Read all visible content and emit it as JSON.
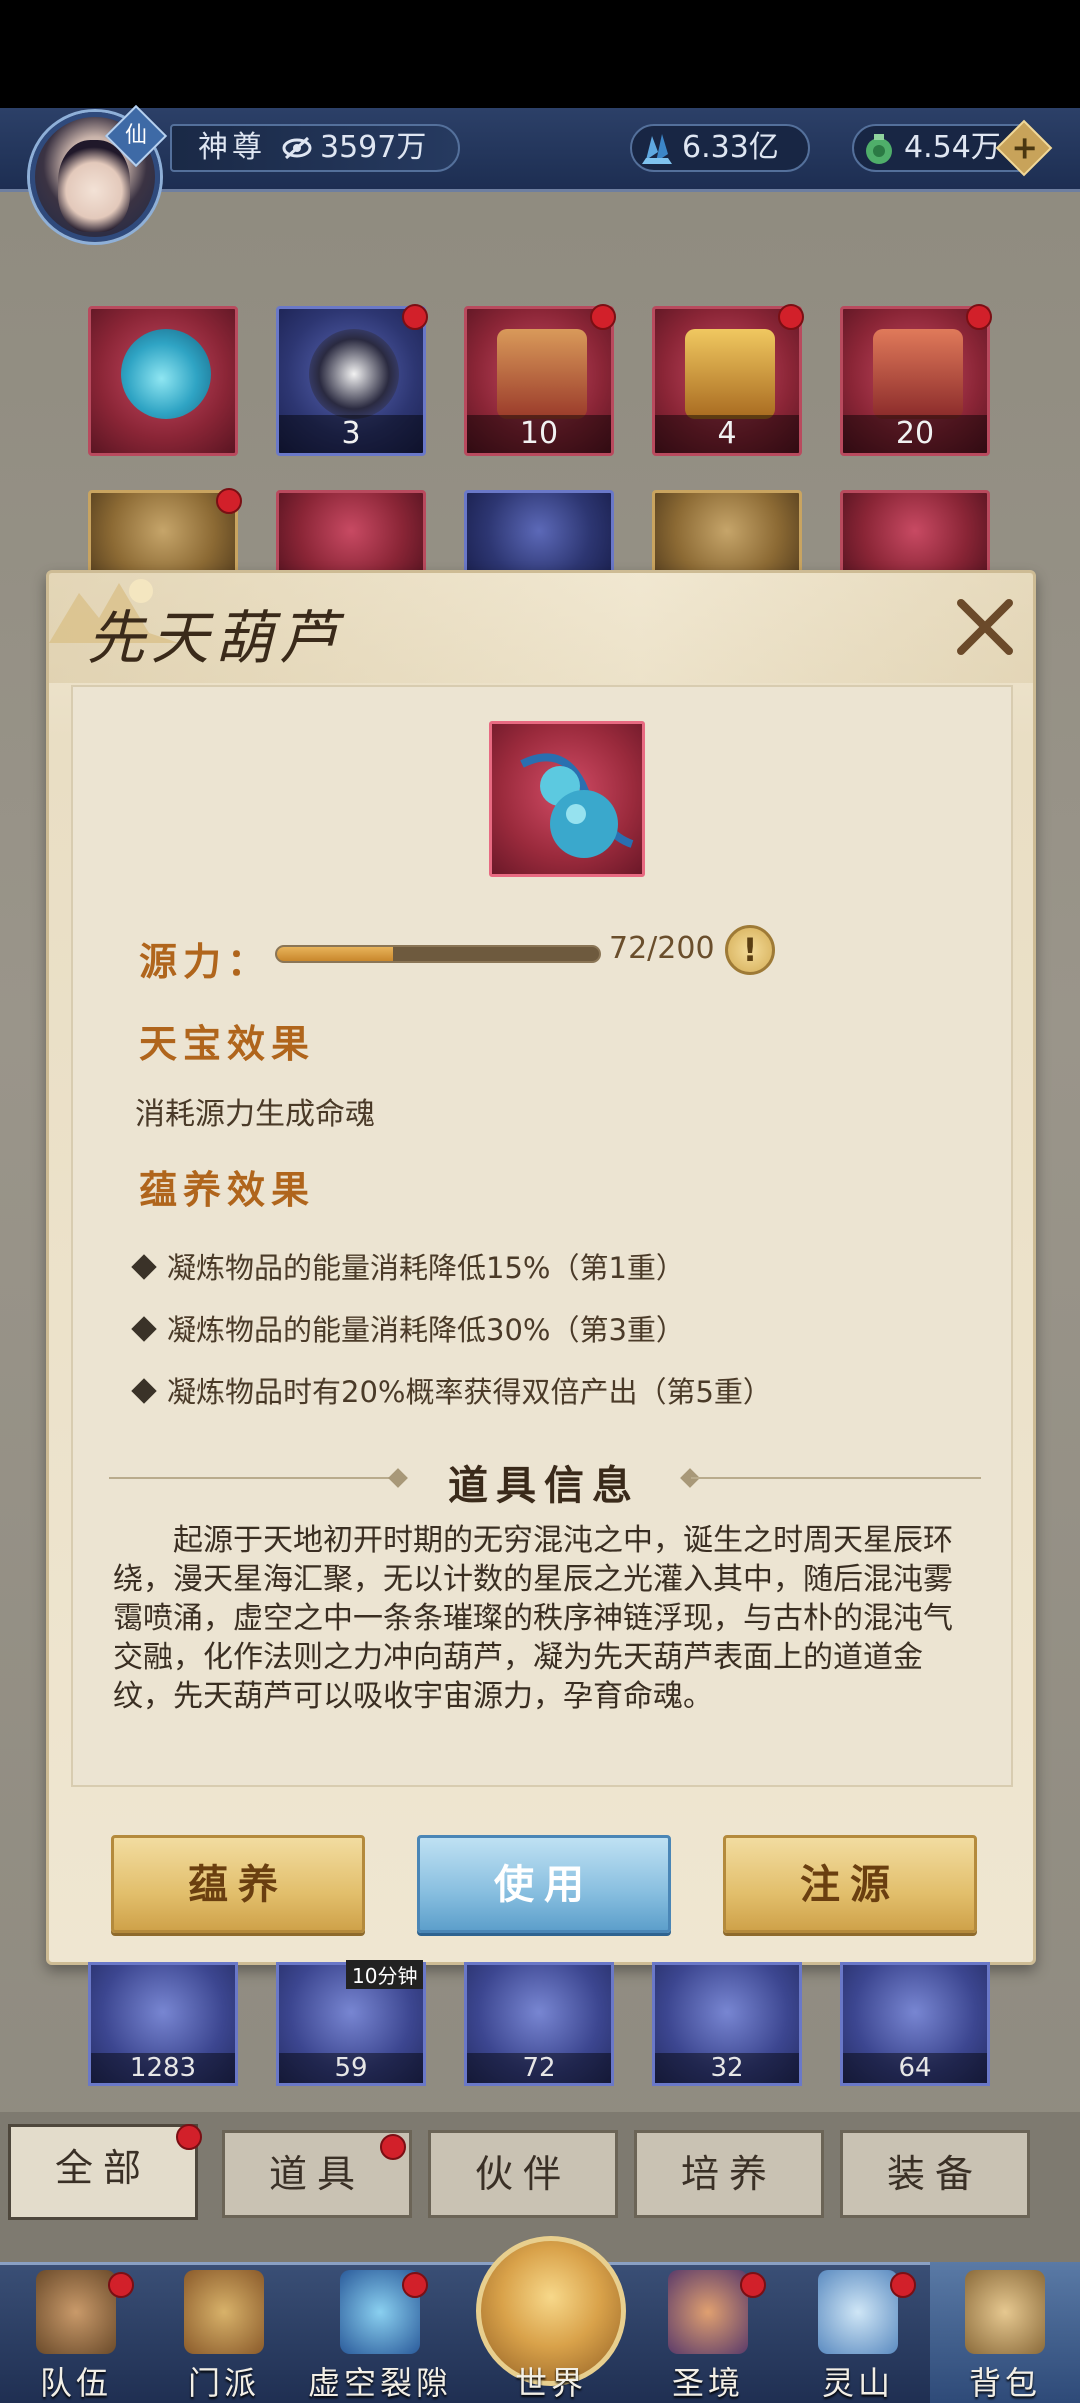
{
  "header": {
    "rank_title": "神尊",
    "power": "3597万",
    "gems": "6.33亿",
    "jade": "4.54万",
    "avatar_badge": "仙",
    "plus_label": "+"
  },
  "inventory": {
    "top_row": [
      {
        "count": ""
      },
      {
        "count": "3"
      },
      {
        "count": "10"
      },
      {
        "count": "4"
      },
      {
        "count": "20"
      }
    ],
    "lower_row": [
      {
        "count": "1283"
      },
      {
        "count": "59"
      },
      {
        "count": "72"
      },
      {
        "count": "32"
      },
      {
        "count": "64"
      }
    ],
    "timer_tag": "10分钟"
  },
  "modal": {
    "title": "先天葫芦",
    "energy": {
      "label": "源力：",
      "current": 72,
      "max": 200,
      "text": "72/200",
      "info_label": "!"
    },
    "treasure_effect": {
      "heading": "天宝效果",
      "text": "消耗源力生成命魂"
    },
    "nurture_effect": {
      "heading": "蕴养效果",
      "items": [
        "凝炼物品的能量消耗降低15%（第1重）",
        "凝炼物品的能量消耗降低30%（第3重）",
        "凝炼物品时有20%概率获得双倍产出（第5重）"
      ]
    },
    "item_info": {
      "heading": "道具信息",
      "lore": "起源于天地初开时期的无穷混沌之中，诞生之时周天星辰环绕，漫天星海汇聚，无以计数的星辰之光灌入其中，随后混沌雾霭喷涌，虚空之中一条条璀璨的秩序神链浮现，与古朴的混沌气交融，化作法则之力冲向葫芦，凝为先天葫芦表面上的道道金纹，先天葫芦可以吸收宇宙源力，孕育命魂。"
    },
    "buttons": {
      "nurture": "蕴养",
      "use": "使用",
      "inject": "注源"
    }
  },
  "tabs": [
    "全部",
    "道具",
    "伙伴",
    "培养",
    "装备"
  ],
  "nav": [
    "队伍",
    "门派",
    "虚空裂隙",
    "世界",
    "圣境",
    "灵山",
    "背包"
  ],
  "colors": {
    "accent_orange": "#b0651c",
    "button_gold": "#e2bf6c",
    "button_blue": "#87bedf",
    "badge_red": "#d2202a",
    "header_blue": "#2c4068"
  }
}
